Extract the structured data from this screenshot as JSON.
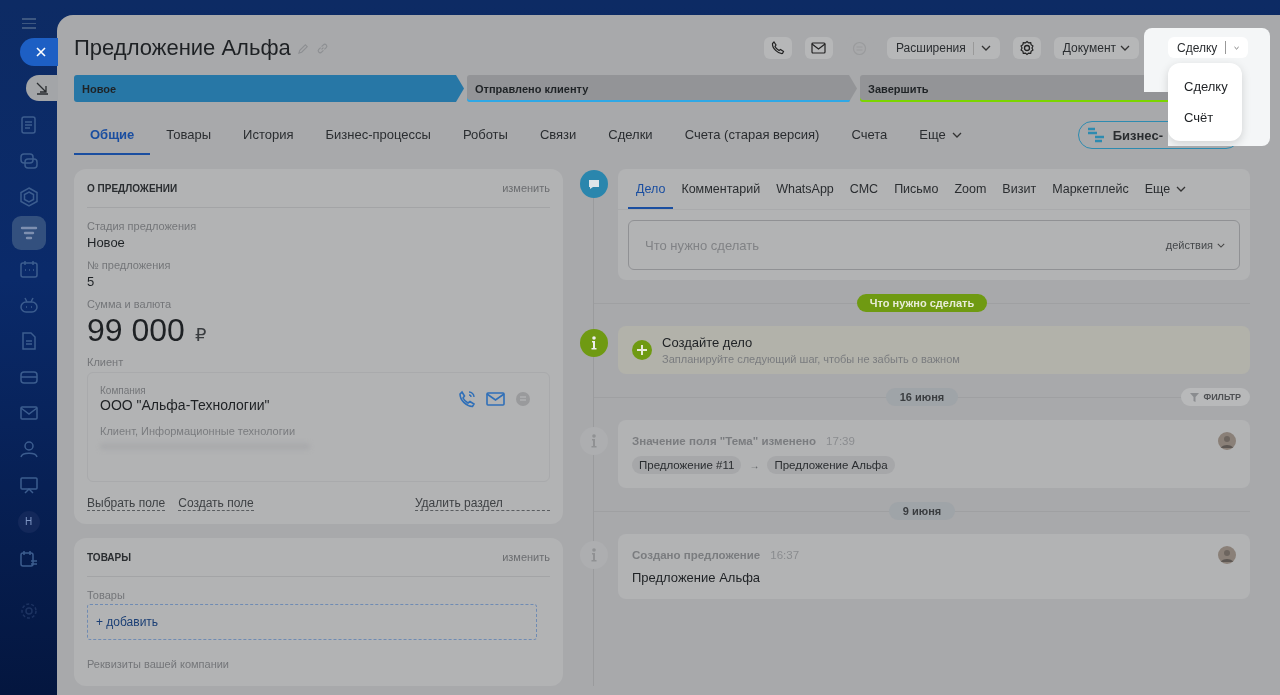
{
  "sidebar": {
    "avatar_letter": "Н"
  },
  "title": "Предложение Альфа",
  "icon_buttons": [
    {
      "kind": "phone",
      "disabled": false
    },
    {
      "kind": "mail",
      "disabled": false
    },
    {
      "kind": "chat",
      "disabled": true
    }
  ],
  "extensions_button": "Расширения",
  "document_button": "Документ",
  "create_button": "Сделку",
  "create_menu": {
    "items": [
      {
        "label": "Сделку"
      },
      {
        "label": "Счёт"
      }
    ]
  },
  "stages": [
    {
      "label": "Новое",
      "selected": true,
      "color": "#2777a6"
    },
    {
      "label": "Отправлено клиенту",
      "selected": false,
      "color": "#2fa8e6"
    },
    {
      "label": "Завершить",
      "selected": false,
      "color": "#7bd500"
    }
  ],
  "tabs": [
    {
      "label": "Общие",
      "selected": true
    },
    {
      "label": "Товары",
      "selected": false
    },
    {
      "label": "История",
      "selected": false
    },
    {
      "label": "Бизнес-процессы",
      "selected": false
    },
    {
      "label": "Роботы",
      "selected": false
    },
    {
      "label": "Связи",
      "selected": false
    },
    {
      "label": "Сделки",
      "selected": false
    },
    {
      "label": "Счета (старая версия)",
      "selected": false
    },
    {
      "label": "Счета",
      "selected": false
    }
  ],
  "tabs_more": "Еще",
  "bp_button": "Бизнес-",
  "about": {
    "title": "О ПРЕДЛОЖЕНИИ",
    "edit": "изменить",
    "fields": [
      {
        "label": "Стадия предложения",
        "value": "Новое"
      },
      {
        "label": "№ предложения",
        "value": "5"
      }
    ],
    "sum_label": "Сумма и валюта",
    "sum": "99 000",
    "currency": "₽",
    "client_label": "Клиент",
    "client": {
      "type_label": "Компания",
      "name": "ООО \"Альфа-Технологии\"",
      "details": "Клиент, Информационные технологии"
    },
    "links": [
      "Выбрать поле",
      "Создать поле"
    ],
    "delete": "Удалить раздел"
  },
  "products": {
    "title": "ТОВАРЫ",
    "edit": "изменить",
    "label": "Товары",
    "add": "+ добавить",
    "requisites_label": "Реквизиты вашей компании"
  },
  "activity": {
    "tabs": [
      {
        "label": "Дело",
        "selected": true
      },
      {
        "label": "Комментарий",
        "selected": false
      },
      {
        "label": "WhatsApp",
        "selected": false
      },
      {
        "label": "СМС",
        "selected": false
      },
      {
        "label": "Письмо",
        "selected": false
      },
      {
        "label": "Zoom",
        "selected": false
      },
      {
        "label": "Визит",
        "selected": false
      },
      {
        "label": "Маркетплейс",
        "selected": false
      }
    ],
    "more": "Еще",
    "placeholder": "Что нужно сделать",
    "actions": "действия"
  },
  "todo_badge": "Что нужно сделать",
  "create_task": {
    "title": "Создайте дело",
    "hint": "Запланируйте следующий шаг, чтобы не забыть о важном"
  },
  "history": [
    {
      "date": "16 июня",
      "filter": "ФИЛЬТР",
      "items": [
        {
          "kind": "change",
          "title": "Значение поля \"Тема\" изменено",
          "time": "17:39",
          "from": "Предложение #11",
          "arrow": "→",
          "to": "Предложение Альфа"
        }
      ]
    },
    {
      "date": "9 июня",
      "items": [
        {
          "kind": "created",
          "title": "Создано предложение",
          "time": "16:37",
          "text": "Предложение Альфа"
        }
      ]
    }
  ]
}
